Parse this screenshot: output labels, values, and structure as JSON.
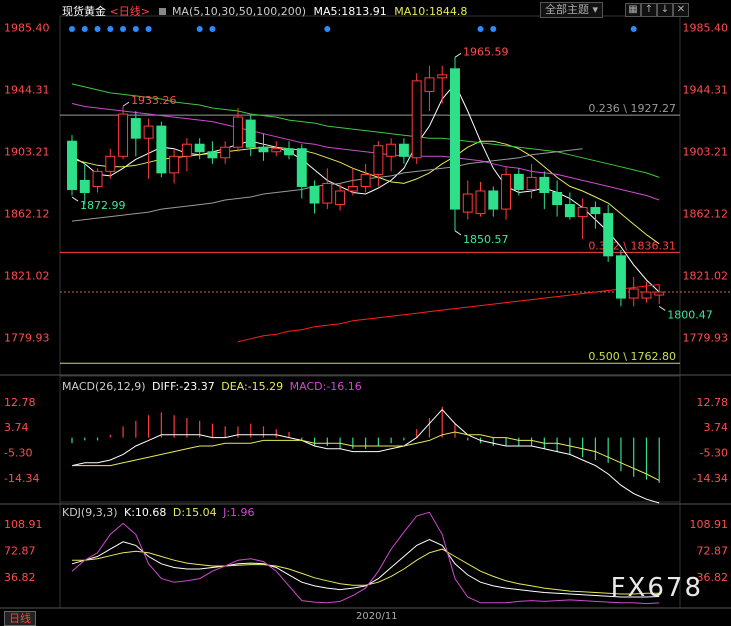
{
  "header": {
    "instrument": "现货黄金",
    "period": "<日线>",
    "ma_label": "MA(5,10,30,50,100,200)",
    "ma5": "MA5:1813.91",
    "ma10": "MA10:1844.8",
    "selector": "全部主题",
    "toolbar": [
      "▦",
      "↑",
      "↓",
      "✕"
    ]
  },
  "macd_header": {
    "label": "MACD(26,12,9)",
    "diff": "DIFF:-23.37",
    "dea": "DEA:-15.29",
    "macd": "MACD:-16.16"
  },
  "kdj_header": {
    "label": "KDJ(9,3,3)",
    "k": "K:10.68",
    "d": "D:15.04",
    "j": "J:1.96"
  },
  "footer": {
    "period": "日线",
    "date": "2020/11"
  },
  "watermark": "FX678",
  "colors": {
    "up": "#ff3b3b",
    "down": "#2ee08a",
    "ma5": "#ffffff",
    "ma10": "#e8e85a",
    "ma30": "#d04ad0",
    "ma50": "#3ec83e",
    "ma100": "#9a9a9a",
    "ma200": "#ff2020",
    "dots": "#2a8cff"
  },
  "chart_data": [
    {
      "type": "candlestick",
      "title": "现货黄金 <日线>",
      "y_ticks": [
        1985.4,
        1944.31,
        1903.21,
        1862.12,
        1821.02,
        1779.93
      ],
      "ylim": [
        1755,
        1993
      ],
      "annotations": [
        {
          "text": "1965.59",
          "x": 30,
          "y": 1965.59
        },
        {
          "text": "1933.26",
          "x": 4,
          "y": 1933.26
        },
        {
          "text": "1872.99",
          "x": 0,
          "y": 1872.99
        },
        {
          "text": "1850.57",
          "x": 30,
          "y": 1850.57
        },
        {
          "text": "1800.47",
          "x": 46,
          "y": 1800.47
        }
      ],
      "fib_levels": [
        {
          "label": "0.236 \\ 1927.27",
          "value": 1927.27,
          "color": "#9a9a9a"
        },
        {
          "label": "0.382 \\ 1836.31",
          "value": 1836.31,
          "color": "#ff4040"
        },
        {
          "label": "0.500 \\ 1762.80",
          "value": 1762.8,
          "color": "#c8e048"
        }
      ],
      "current_price": 1810,
      "candles": [
        {
          "o": 1910,
          "h": 1914,
          "l": 1874,
          "c": 1878
        },
        {
          "o": 1884,
          "h": 1896,
          "l": 1868,
          "c": 1876
        },
        {
          "o": 1880,
          "h": 1892,
          "l": 1876,
          "c": 1890
        },
        {
          "o": 1890,
          "h": 1905,
          "l": 1885,
          "c": 1900
        },
        {
          "o": 1900,
          "h": 1933,
          "l": 1898,
          "c": 1928
        },
        {
          "o": 1925,
          "h": 1930,
          "l": 1900,
          "c": 1912
        },
        {
          "o": 1912,
          "h": 1925,
          "l": 1885,
          "c": 1920
        },
        {
          "o": 1920,
          "h": 1923,
          "l": 1886,
          "c": 1889
        },
        {
          "o": 1889,
          "h": 1905,
          "l": 1882,
          "c": 1900
        },
        {
          "o": 1900,
          "h": 1912,
          "l": 1890,
          "c": 1908
        },
        {
          "o": 1908,
          "h": 1912,
          "l": 1898,
          "c": 1903
        },
        {
          "o": 1903,
          "h": 1910,
          "l": 1895,
          "c": 1899
        },
        {
          "o": 1899,
          "h": 1910,
          "l": 1895,
          "c": 1906
        },
        {
          "o": 1906,
          "h": 1932,
          "l": 1903,
          "c": 1926
        },
        {
          "o": 1924,
          "h": 1927,
          "l": 1900,
          "c": 1906
        },
        {
          "o": 1906,
          "h": 1915,
          "l": 1897,
          "c": 1903
        },
        {
          "o": 1903,
          "h": 1910,
          "l": 1900,
          "c": 1905
        },
        {
          "o": 1905,
          "h": 1910,
          "l": 1898,
          "c": 1901
        },
        {
          "o": 1905,
          "h": 1908,
          "l": 1872,
          "c": 1880
        },
        {
          "o": 1880,
          "h": 1884,
          "l": 1862,
          "c": 1869
        },
        {
          "o": 1869,
          "h": 1892,
          "l": 1865,
          "c": 1882
        },
        {
          "o": 1868,
          "h": 1882,
          "l": 1864,
          "c": 1877
        },
        {
          "o": 1877,
          "h": 1892,
          "l": 1874,
          "c": 1880
        },
        {
          "o": 1880,
          "h": 1895,
          "l": 1876,
          "c": 1888
        },
        {
          "o": 1888,
          "h": 1910,
          "l": 1880,
          "c": 1907
        },
        {
          "o": 1900,
          "h": 1912,
          "l": 1890,
          "c": 1908
        },
        {
          "o": 1908,
          "h": 1912,
          "l": 1895,
          "c": 1900
        },
        {
          "o": 1899,
          "h": 1955,
          "l": 1895,
          "c": 1950
        },
        {
          "o": 1943,
          "h": 1960,
          "l": 1930,
          "c": 1952
        },
        {
          "o": 1952,
          "h": 1960,
          "l": 1935,
          "c": 1954
        },
        {
          "o": 1958,
          "h": 1965.59,
          "l": 1850.57,
          "c": 1865
        },
        {
          "o": 1863,
          "h": 1884,
          "l": 1858,
          "c": 1875
        },
        {
          "o": 1862,
          "h": 1883,
          "l": 1860,
          "c": 1877
        },
        {
          "o": 1877,
          "h": 1880,
          "l": 1860,
          "c": 1865
        },
        {
          "o": 1865,
          "h": 1893,
          "l": 1858,
          "c": 1888
        },
        {
          "o": 1888,
          "h": 1892,
          "l": 1874,
          "c": 1878
        },
        {
          "o": 1878,
          "h": 1895,
          "l": 1872,
          "c": 1886
        },
        {
          "o": 1886,
          "h": 1890,
          "l": 1865,
          "c": 1876
        },
        {
          "o": 1876,
          "h": 1884,
          "l": 1860,
          "c": 1868
        },
        {
          "o": 1868,
          "h": 1876,
          "l": 1858,
          "c": 1860
        },
        {
          "o": 1860,
          "h": 1872,
          "l": 1845,
          "c": 1866
        },
        {
          "o": 1866,
          "h": 1870,
          "l": 1852,
          "c": 1862
        },
        {
          "o": 1862,
          "h": 1868,
          "l": 1830,
          "c": 1834
        },
        {
          "o": 1834,
          "h": 1838,
          "l": 1800.47,
          "c": 1806
        },
        {
          "o": 1806,
          "h": 1820,
          "l": 1800.47,
          "c": 1812
        },
        {
          "o": 1806,
          "h": 1817,
          "l": 1803,
          "c": 1810
        },
        {
          "o": 1808,
          "h": 1815,
          "l": 1802,
          "c": 1810
        }
      ],
      "ma": {
        "ma5": [
          1900,
          1895,
          1888,
          1887,
          1892,
          1898,
          1902,
          1906,
          1905,
          1902,
          1901,
          1903,
          1905,
          1908,
          1910,
          1908,
          1906,
          1903,
          1898,
          1891,
          1884,
          1880,
          1876,
          1875,
          1879,
          1884,
          1892,
          1908,
          1920,
          1938,
          1948,
          1930,
          1910,
          1892,
          1880,
          1876,
          1877,
          1879,
          1876,
          1872,
          1866,
          1858,
          1850,
          1840,
          1828,
          1818,
          1810
        ],
        "ma10": [
          1898,
          1896,
          1894,
          1893,
          1893,
          1894,
          1896,
          1898,
          1899,
          1900,
          1901,
          1902,
          1903,
          1904,
          1905,
          1906,
          1906,
          1905,
          1904,
          1902,
          1899,
          1896,
          1892,
          1889,
          1886,
          1883,
          1882,
          1885,
          1889,
          1895,
          1900,
          1906,
          1910,
          1910,
          1908,
          1905,
          1900,
          1893,
          1886,
          1880,
          1877,
          1873,
          1869,
          1862,
          1855,
          1848,
          1842
        ],
        "ma30": [
          1935,
          1933,
          1932,
          1931,
          1930,
          1929,
          1928,
          1927,
          1926,
          1925,
          1924,
          1923,
          1921,
          1919,
          1917,
          1915,
          1913,
          1911,
          1909,
          1908,
          1906,
          1905,
          1904,
          1903,
          1902,
          1901,
          1900,
          1900,
          1900,
          1900,
          1899,
          1898,
          1897,
          1895,
          1893,
          1892,
          1890,
          1889,
          1888,
          1886,
          1884,
          1882,
          1880,
          1878,
          1876,
          1874,
          1871
        ],
        "ma50": [
          1948,
          1946,
          1944,
          1942,
          1941,
          1940,
          1939,
          1938,
          1936,
          1935,
          1934,
          1932,
          1931,
          1930,
          1928,
          1927,
          1926,
          1924,
          1923,
          1922,
          1920,
          1919,
          1918,
          1917,
          1916,
          1915,
          1914,
          1913,
          1912,
          1912,
          1911,
          1910,
          1909,
          1908,
          1907,
          1906,
          1905,
          1904,
          1903,
          1901,
          1899,
          1897,
          1895,
          1893,
          1891,
          1889,
          1886
        ],
        "ma100": [
          1857,
          1858,
          1859,
          1860,
          1861,
          1862,
          1863,
          1865,
          1866,
          1867,
          1868,
          1869,
          1871,
          1872,
          1873,
          1875,
          1876,
          1877,
          1878,
          1880,
          1881,
          1882,
          1884,
          1885,
          1886,
          1887,
          1889,
          1890,
          1891,
          1892,
          1893,
          1895,
          1896,
          1897,
          1898,
          1899,
          1901,
          1902,
          1903,
          1904,
          1905,
          1906,
          1906,
          1907,
          1907,
          1907,
          1907
        ],
        "ma200": [
          1750,
          1752,
          1754,
          1757,
          1759,
          1761,
          1763,
          1765,
          1767,
          1769,
          1771,
          1773,
          1775,
          1777,
          1779,
          1781,
          1782,
          1784,
          1785,
          1787,
          1788,
          1789,
          1791,
          1792,
          1793,
          1794,
          1795,
          1796,
          1797,
          1798,
          1799,
          1800,
          1801,
          1802,
          1803,
          1804,
          1805,
          1806,
          1807,
          1808,
          1809,
          1810,
          1811,
          1812,
          1813,
          1814,
          1815
        ]
      },
      "ma_windows": {
        "ma5": [
          0,
          46
        ],
        "ma10": [
          0,
          46
        ],
        "ma30": [
          0,
          46
        ],
        "ma50": [
          0,
          46
        ],
        "ma100": [
          0,
          40
        ],
        "ma200": [
          13,
          46
        ]
      },
      "signal_dots": [
        0,
        1,
        2,
        3,
        4,
        5,
        6,
        10,
        11,
        20,
        32,
        33,
        44
      ]
    },
    {
      "type": "bar",
      "title": "MACD(26,12,9)",
      "y_ticks": [
        12.78,
        3.74,
        -5.3,
        -14.34
      ],
      "ylim": [
        -23,
        17
      ],
      "histogram": [
        -2,
        -1,
        -1,
        1,
        4,
        6,
        8,
        9,
        8,
        7,
        6,
        5,
        4,
        4,
        5,
        4,
        3,
        2,
        -1,
        -3,
        -3,
        -4,
        -4,
        -4,
        -3,
        -2,
        -1,
        3,
        7,
        11,
        5,
        -1,
        -2,
        -3,
        -3,
        -3,
        -3,
        -4,
        -5,
        -6,
        -7,
        -8,
        -9,
        -12,
        -14,
        -15,
        -16.16
      ],
      "diff": [
        -10,
        -9,
        -9,
        -8,
        -6,
        -3,
        -1,
        1,
        1,
        1,
        1,
        0,
        0,
        1,
        1,
        1,
        1,
        0,
        -1,
        -3,
        -4,
        -4,
        -5,
        -5,
        -5,
        -4,
        -3,
        0,
        5,
        10,
        5,
        1,
        -1,
        -2,
        -3,
        -3,
        -3,
        -4,
        -5,
        -6,
        -8,
        -10,
        -13,
        -17,
        -20,
        -22,
        -23.37
      ],
      "dea": [
        -10,
        -10,
        -10,
        -10,
        -9,
        -8,
        -7,
        -6,
        -5,
        -4,
        -3,
        -3,
        -2,
        -2,
        -2,
        -1,
        -1,
        -1,
        -1,
        -2,
        -2,
        -2,
        -3,
        -3,
        -3,
        -3,
        -3,
        -2,
        -1,
        1,
        2,
        1,
        1,
        0,
        0,
        -1,
        -1,
        -2,
        -2,
        -3,
        -4,
        -5,
        -7,
        -9,
        -11,
        -13,
        -15.29
      ]
    },
    {
      "type": "line",
      "title": "KDJ(9,3,3)",
      "y_ticks": [
        108.91,
        72.87,
        36.82
      ],
      "ylim": [
        -5,
        120
      ],
      "k": [
        55,
        60,
        65,
        75,
        85,
        80,
        65,
        55,
        50,
        48,
        48,
        50,
        52,
        55,
        56,
        55,
        50,
        40,
        30,
        25,
        22,
        20,
        22,
        25,
        35,
        50,
        65,
        80,
        88,
        80,
        55,
        40,
        30,
        25,
        22,
        20,
        18,
        16,
        15,
        14,
        13,
        12,
        11,
        10,
        10,
        10,
        10.68
      ],
      "d": [
        60,
        60,
        62,
        66,
        70,
        72,
        70,
        65,
        60,
        56,
        54,
        52,
        52,
        53,
        54,
        54,
        52,
        48,
        42,
        36,
        32,
        28,
        26,
        26,
        30,
        38,
        48,
        60,
        70,
        75,
        65,
        55,
        45,
        38,
        32,
        28,
        25,
        22,
        20,
        18,
        17,
        16,
        15,
        14,
        14,
        15,
        15.04
      ],
      "j": [
        45,
        60,
        70,
        95,
        110,
        95,
        55,
        35,
        30,
        32,
        35,
        45,
        52,
        60,
        62,
        58,
        45,
        25,
        5,
        3,
        2,
        4,
        12,
        22,
        45,
        75,
        98,
        120,
        125,
        95,
        35,
        10,
        2,
        2,
        2,
        4,
        5,
        4,
        5,
        6,
        5,
        4,
        3,
        2,
        2,
        1,
        1.96
      ]
    }
  ]
}
